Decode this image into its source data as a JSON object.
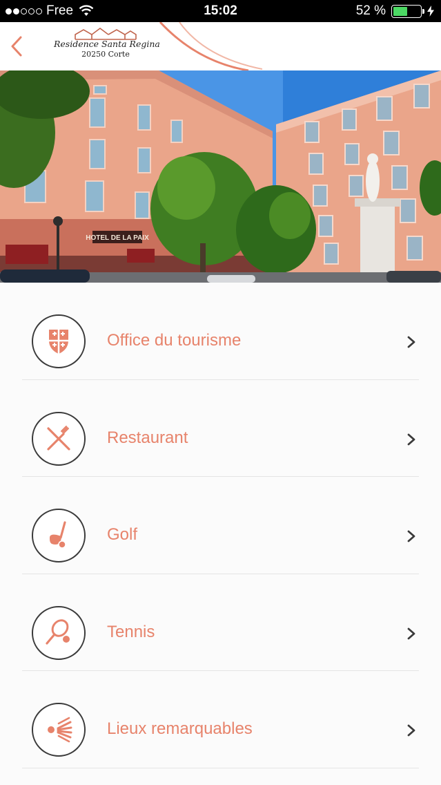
{
  "status_bar": {
    "carrier": "Free",
    "time": "15:02",
    "battery_text": "52 %",
    "battery_level": 0.52
  },
  "header": {
    "logo_name": "Residence Santa Regina",
    "logo_address": "20250 Corte"
  },
  "hero": {
    "sign_text": "HOTEL DE LA PAIX"
  },
  "menu": {
    "items": [
      {
        "label": "Office du tourisme",
        "icon": "coat-of-arms-icon"
      },
      {
        "label": "Restaurant",
        "icon": "fork-knife-icon"
      },
      {
        "label": "Golf",
        "icon": "golf-club-icon"
      },
      {
        "label": "Tennis",
        "icon": "tennis-racket-icon"
      },
      {
        "label": "Lieux remarquables",
        "icon": "sunburst-icon"
      }
    ]
  },
  "colors": {
    "accent": "#e7836b",
    "icon_outline": "#3a3a3a",
    "divider": "#e4e4e4"
  }
}
